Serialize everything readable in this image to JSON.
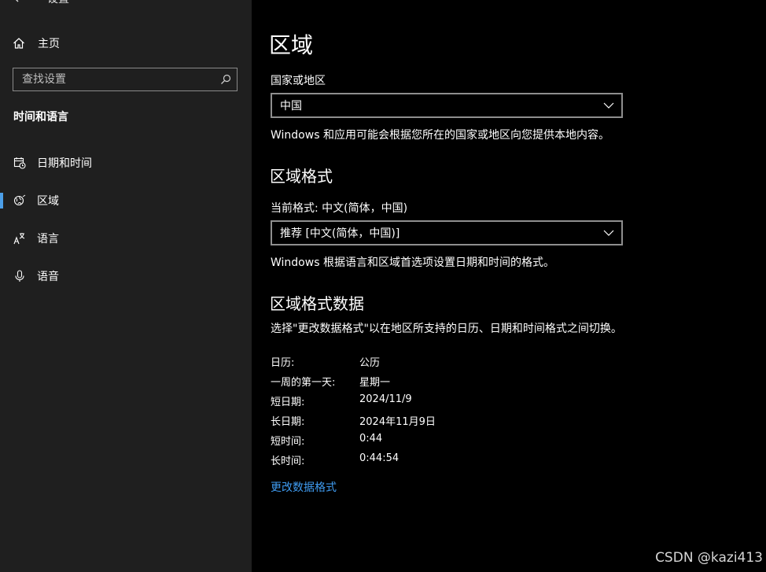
{
  "window": {
    "back_label": "设置"
  },
  "sidebar": {
    "home_label": "主页",
    "search_placeholder": "查找设置",
    "section_title": "时间和语言",
    "items": [
      {
        "label": "日期和时间",
        "icon": "calendar-clock-icon",
        "selected": false
      },
      {
        "label": "区域",
        "icon": "globe-region-icon",
        "selected": true
      },
      {
        "label": "语言",
        "icon": "language-icon",
        "selected": false
      },
      {
        "label": "语音",
        "icon": "microphone-icon",
        "selected": false
      }
    ]
  },
  "main": {
    "title": "区域",
    "country": {
      "label": "国家或地区",
      "value": "中国",
      "description": "Windows 和应用可能会根据您所在的国家或地区向您提供本地内容。"
    },
    "region_format": {
      "heading": "区域格式",
      "current_label": "当前格式: 中文(简体，中国)",
      "value": "推荐 [中文(简体，中国)]",
      "description": "Windows 根据语言和区域首选项设置日期和时间的格式。"
    },
    "format_data": {
      "heading": "区域格式数据",
      "description": "选择\"更改数据格式\"以在地区所支持的日历、日期和时间格式之间切换。",
      "rows": [
        {
          "key": "日历:",
          "value": "公历"
        },
        {
          "key": "一周的第一天:",
          "value": "星期一"
        },
        {
          "key": "短日期:",
          "value": "2024/11/9"
        },
        {
          "key": "长日期:",
          "value": "2024年11月9日"
        },
        {
          "key": "短时间:",
          "value": "0:44"
        },
        {
          "key": "长时间:",
          "value": "0:44:54"
        }
      ],
      "change_link": "更改数据格式"
    }
  },
  "watermark": "CSDN @kazi413",
  "colors": {
    "accent": "#4c9fe8",
    "link": "#3f9bf0",
    "sidebar_bg": "#1f1f1f",
    "main_bg": "#000000"
  }
}
